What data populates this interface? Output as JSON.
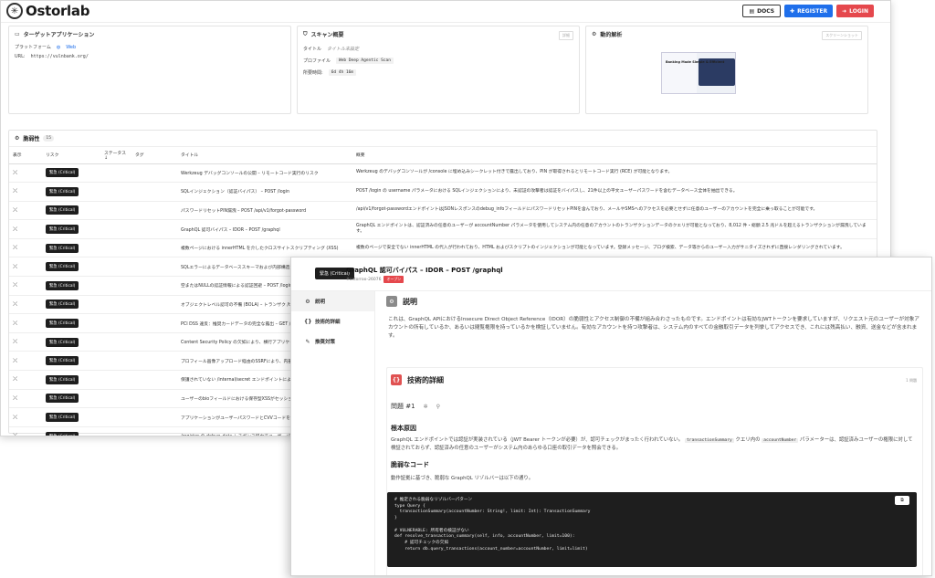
{
  "app": {
    "logo_text": "Ostorlab"
  },
  "topbar": {
    "docs": "DOCS",
    "register": "REGISTER",
    "login": "LOGIN"
  },
  "target": {
    "title": "ターゲットアプリケーション",
    "platform_label": "プラットフォーム",
    "platform_value": "Web",
    "url_label": "URL:",
    "url_value": "https://vulnbank.org/"
  },
  "scan": {
    "title": "スキャン概要",
    "details_btn": "詳細",
    "title_label": "タイトル",
    "title_value": "タイトル未設定",
    "profile_label": "プロファイル",
    "profile_value": "Web Deep Agentic Scan",
    "duration_label": "所要時間:",
    "duration_value": "6d 4h 16m"
  },
  "dynamic": {
    "title": "動的解析",
    "btn": "スクリーンショット",
    "thumb_text": "Banking Made Simple & Efficient"
  },
  "vulns": {
    "title": "脆弱性",
    "count": "15",
    "headers": [
      "表示",
      "リスク",
      "ステータス ↓",
      "タグ",
      "タイトル",
      "概要"
    ],
    "rows": [
      {
        "risk": "緊急 (Critical)",
        "title": "Werkzeug デバッグコンソールの公開 – リモートコード実行のリスク",
        "summary": "Werkzeug のデバッグコンソールが /console に埋め込みシークレット付きで露出しており、PIN が取得されるとリモートコード実行 (RCE) が可能となります。"
      },
      {
        "risk": "緊急 (Critical)",
        "title": "SQLインジェクション（認証バイパス） – POST /login",
        "summary": "POST /login の username パラメータにおける SQLインジェクションにより、未認証の攻撃者は認証をバイパスし、21件以上の平文ユーザーパスワードを含むデータベース全体を抽出できる。"
      },
      {
        "risk": "緊急 (Critical)",
        "title": "パスワードリセットPIN漏洩 – POST /api/v1/forgot-password",
        "summary": "/api/v1/forgot-passwordエンドポイントはJSONレスポンスのdebug_infoフィールドにパスワードリセットPINを含んでおり、メールやSMSへのアクセスを必要とせずに任意のユーザーのアカウントを完全に乗っ取ることが可能です。"
      },
      {
        "risk": "緊急 (Critical)",
        "title": "GraphQL 認可バイパス – IDOR – POST /graphql",
        "summary": "GraphQL エンドポイントは、認証済みの任意のユーザーが accountNumber パラメータを使用してシステム内の任意のアカウントのトランザクションデータのクエリが可能となっており、8,012 件・総額 2.5 兆ドルを超えるトランザクションが漏洩しています。"
      },
      {
        "risk": "緊急 (Critical)",
        "title": "複数ページにおける innerHTML を介したクロスサイトスクリプティング (XSS)",
        "summary": "複数のページで安全でない innerHTML の代入が行われており、HTML およびスクリプトのインジェクションが可能となっています。登録メッセージ、ブログ検索、データ等からのユーザー入力がサニタイズされずに直接レンダリングされています。"
      },
      {
        "risk": "緊急 (Critical)",
        "title": "SQLエラーによるデータベーススキーマおよび内部構造",
        "summary": ""
      },
      {
        "risk": "緊急 (Critical)",
        "title": "空またはNULLの認証情報による認証回避 – POST /login",
        "summary": ""
      },
      {
        "risk": "緊急 (Critical)",
        "title": "オブジェクトレベル認可の不備 (BOLA) – トランザク /transactions/{account_number}",
        "summary": ""
      },
      {
        "risk": "緊急 (Critical)",
        "title": "PCI DSS 違反：推奨カードデータの完全な露出 – GET /",
        "summary": ""
      },
      {
        "risk": "緊急 (Critical)",
        "title": "Content Security Policy の欠如により、横行アプリケー れる",
        "summary": ""
      },
      {
        "risk": "緊急 (Critical)",
        "title": "プロフィール画像アップロード経由のSSRFにより、内部 よび機密データの流出が可能",
        "summary": ""
      },
      {
        "risk": "緊急 (Critical)",
        "title": "保護されていない /internal/secret エンドポイントによ",
        "summary": ""
      },
      {
        "risk": "緊急 (Critical)",
        "title": "ユーザーのbioフィールドにおける保存型XSSがセッショ する",
        "summary": ""
      },
      {
        "risk": "緊急 (Critical)",
        "title": "アプリケーションがユーザーパスワードとCVVコードを",
        "summary": ""
      },
      {
        "risk": "緊急 (Critical)",
        "title": "/register の debug_data レスポンス経由でユーザーパ",
        "summary": ""
      }
    ]
  },
  "detail": {
    "risk": "緊急 (Critical)",
    "title": "GraphQL 認可バイパス – IDOR – POST /graphql",
    "id": "#ostorroo-26076",
    "status": "オープン",
    "nav": [
      "説明",
      "技術的詳細",
      "推奨対策"
    ],
    "desc_title": "説明",
    "desc_text": "これは、GraphQL APIにおけるInsecure Direct Object Reference（IDOR）の脆弱性とアクセス制御の不備が組み合わさったものです。エンドポイントは有効なJWTトークンを要求していますが、リクエスト元のユーザーが対象アカウントの所有しているか、あるいは閲覧権限を持っているかを検証していません。有効なアカウントを持つ攻撃者は、システム内のすべての金融取引データを列挙してアクセスでき、これには残高払い、融資、送金などが含まれます。",
    "tech_title": "技術的詳細",
    "issues": "1 問題",
    "problem": "問題 #1",
    "root_title": "根本原因",
    "root_text_1": "GraphQL エンドポイントでは認証が実装されている（JWT Bearer トークンが必要）が、認可チェックがまったく行われていない。",
    "root_code_1": "transactionSummary",
    "root_text_2": "クエリ内の",
    "root_code_2": "accountNumber",
    "root_text_3": "パラメーターは、認証済みユーザーの権限に対して検証されておらず、認証済みの任意のユーザーがシステム内のあらゆる口座の取引データを照会できる。",
    "vuln_code_title": "脆弱なコード",
    "vuln_code_text": "動作証拠に基づき、脆弱な GraphQL リゾルバーは以下の通り。",
    "code": "# 推定される脆弱なリゾルバーパターン\ntype Query {\n  transactionSummary(accountNumber: String!, limit: Int): TransactionSummary\n}\n\n# VULNERABLE: 所有者の検証がない\ndef resolve_transaction_summary(self, info, accountNumber, limit=100):\n    # 認可チェックの欠如\n    return db.query_transactions(account_number=accountNumber, limit=limit)"
  }
}
